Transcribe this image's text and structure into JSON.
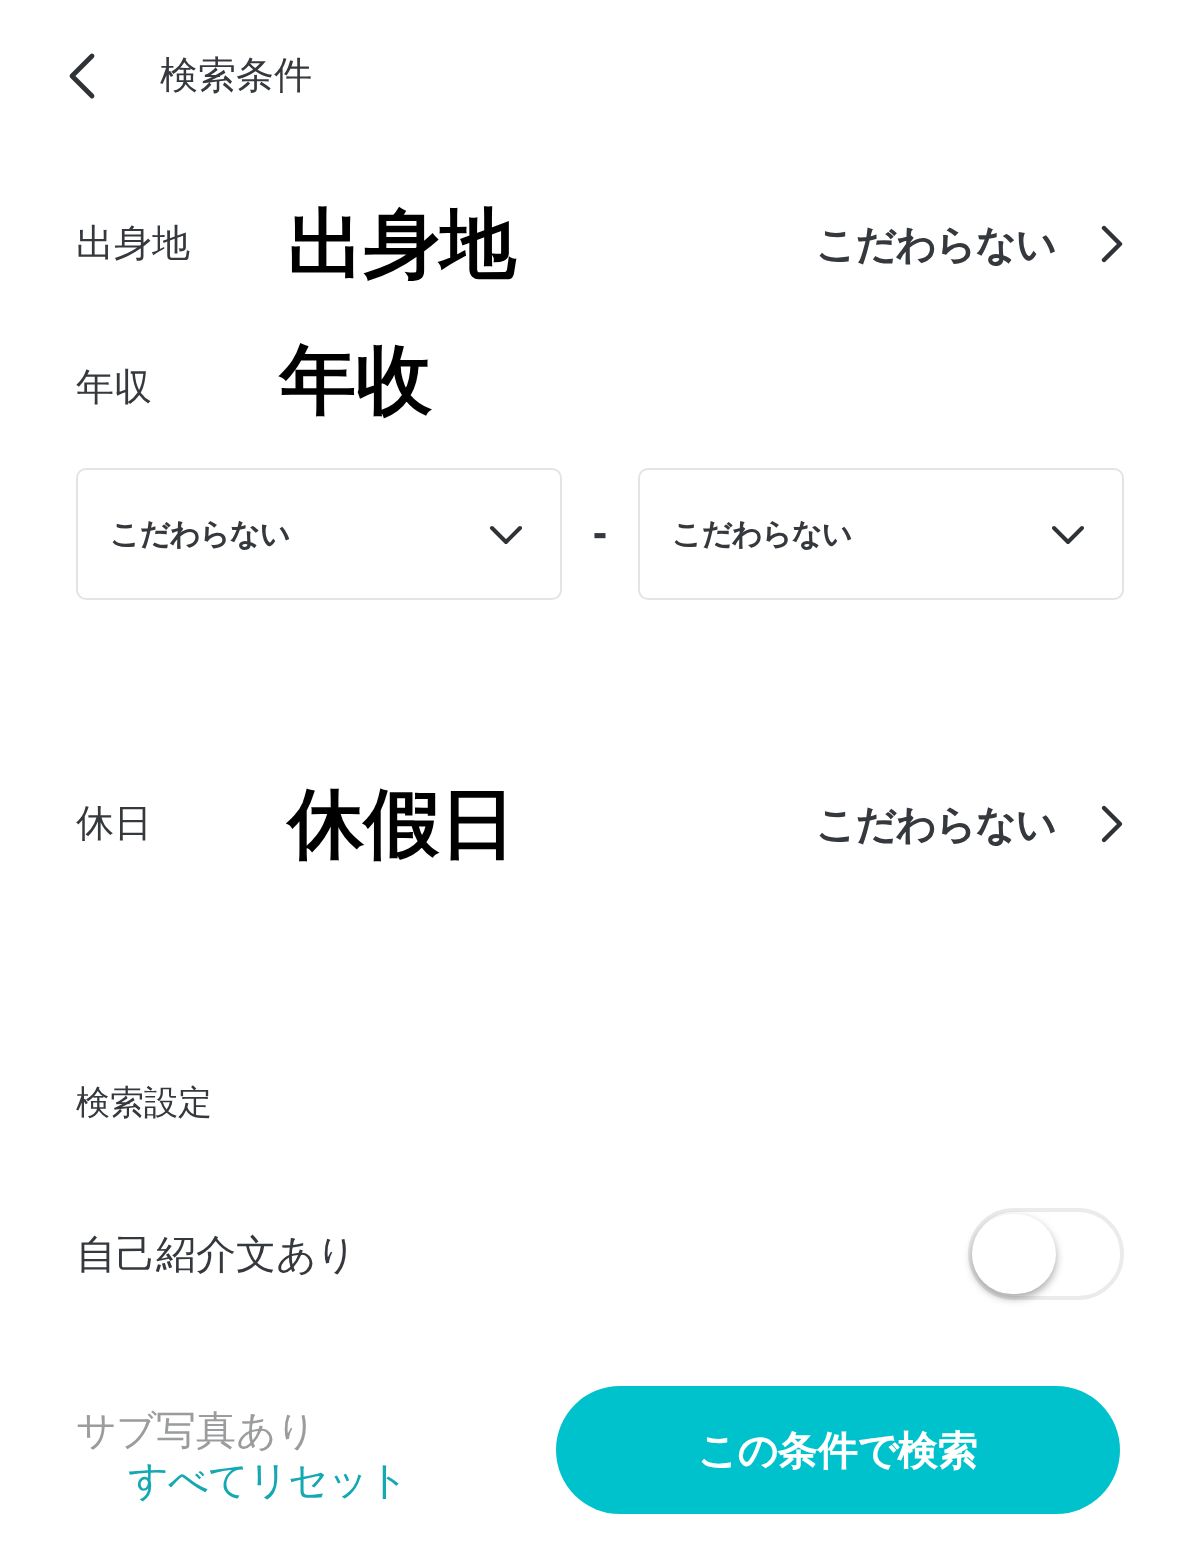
{
  "header": {
    "title": "検索条件"
  },
  "rows": [
    {
      "kind": "link",
      "label": "出身地",
      "annotation": "出身地",
      "value": "こだわらない"
    },
    {
      "kind": "range",
      "label": "年収",
      "annotation": "年收",
      "selects": [
        "こだわらない",
        "こだわらない"
      ],
      "separator": "-"
    },
    {
      "kind": "link",
      "label": "休日",
      "annotation": "休假日",
      "value": "こだわらない"
    }
  ],
  "settings": {
    "title": "検索設定",
    "toggles": [
      {
        "kind": "switch",
        "label": "自己紹介文あり",
        "on": false
      },
      {
        "kind": "covered",
        "label": "サブ写真あり"
      }
    ]
  },
  "footer": {
    "reset": "すべてリセット",
    "search": "この条件で検索"
  }
}
